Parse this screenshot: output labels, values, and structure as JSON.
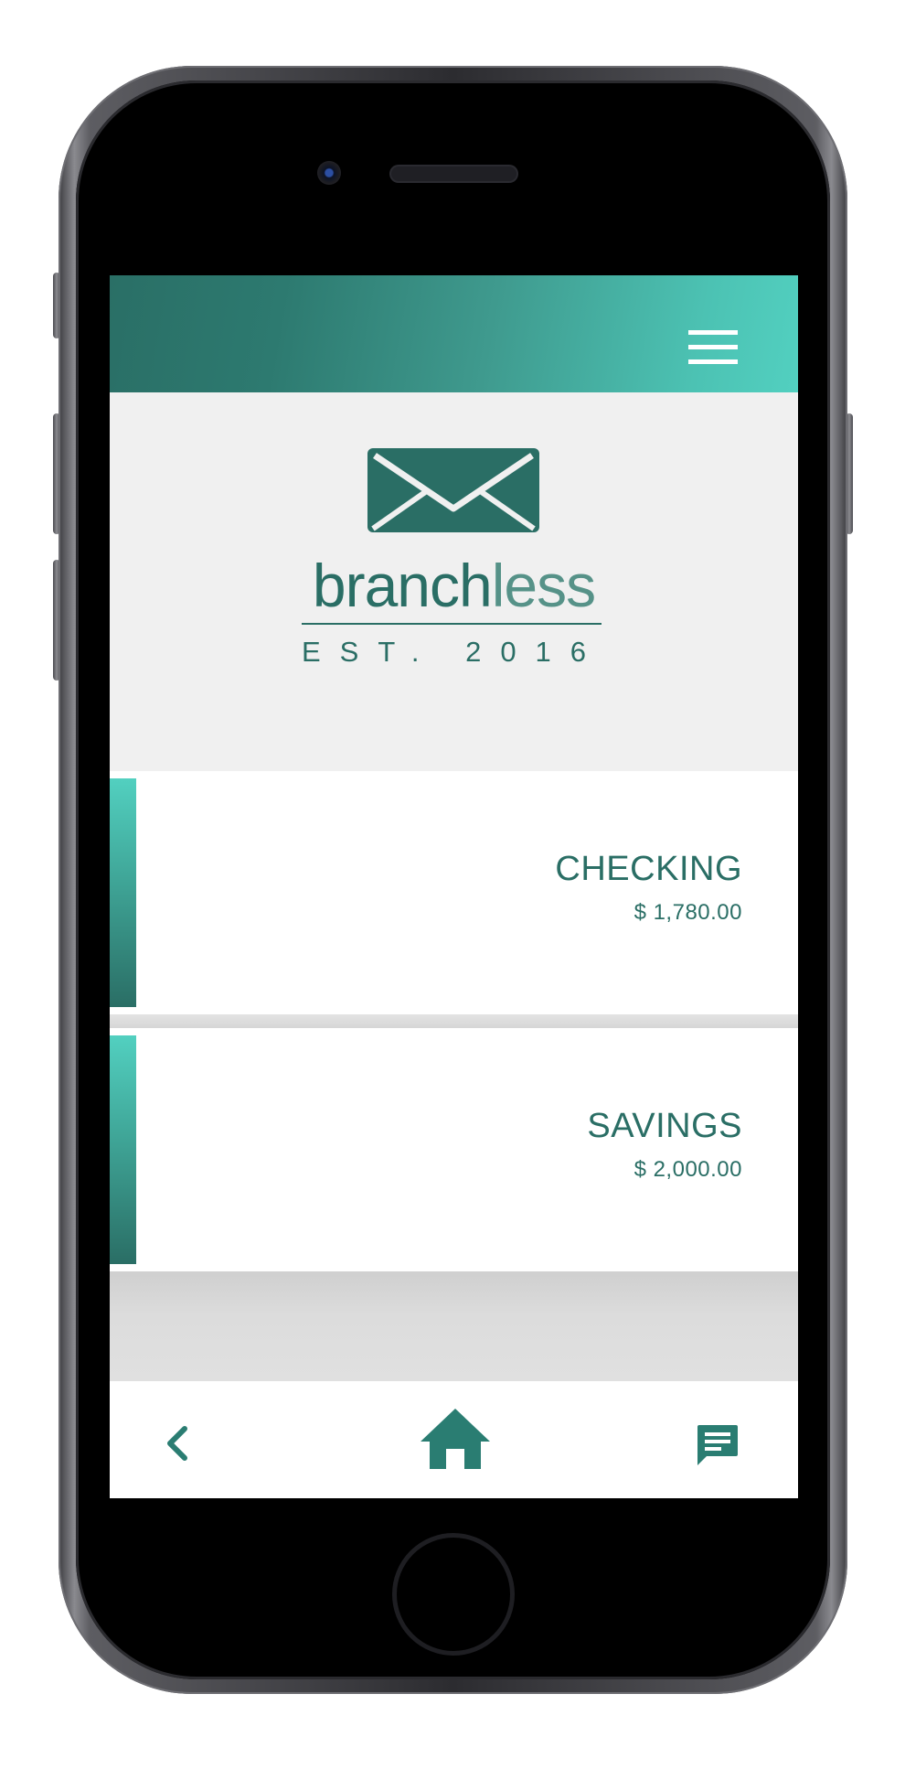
{
  "app": {
    "brand_main": "branch",
    "brand_light": "less",
    "tagline": "EST. 2016"
  },
  "colors": {
    "primary": "#2a6e65",
    "accent": "#52d0c0",
    "background": "#efefef"
  },
  "header": {
    "menu_icon": "hamburger-menu-icon"
  },
  "logo": {
    "icon": "envelope-icon"
  },
  "accounts": [
    {
      "name": "CHECKING",
      "balance": "$ 1,780.00"
    },
    {
      "name": "SAVINGS",
      "balance": "$ 2,000.00"
    }
  ],
  "footer": {
    "back_icon": "chevron-left-icon",
    "home_icon": "home-icon",
    "chat_icon": "chat-icon"
  }
}
